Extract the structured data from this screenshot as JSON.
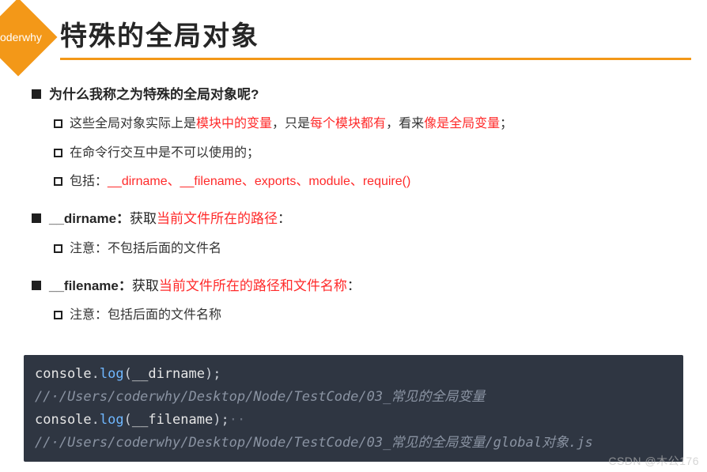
{
  "badge": "coderwhy",
  "title": "特殊的全局对象",
  "sections": [
    {
      "head": "为什么我称之为特殊的全局对象呢?",
      "items": [
        {
          "segments": [
            {
              "t": "这些全局对象实际上是",
              "c": ""
            },
            {
              "t": "模块中的变量",
              "c": "red"
            },
            {
              "t": "，只是",
              "c": ""
            },
            {
              "t": "每个模块都有",
              "c": "red"
            },
            {
              "t": "，看来",
              "c": ""
            },
            {
              "t": "像是全局变量",
              "c": "red"
            },
            {
              "t": "；",
              "c": ""
            }
          ]
        },
        {
          "segments": [
            {
              "t": "在命令行交互中是不可以使用的；",
              "c": ""
            }
          ]
        },
        {
          "segments": [
            {
              "t": "包括：",
              "c": ""
            },
            {
              "t": "__dirname、__filename、exports、module、require()",
              "c": "red"
            }
          ]
        }
      ]
    },
    {
      "head_segments": [
        {
          "t": "__dirname：",
          "c": ""
        },
        {
          "t": "获取",
          "c": "plain"
        },
        {
          "t": "当前文件所在的路径",
          "c": "red"
        },
        {
          "t": "：",
          "c": "plain"
        }
      ],
      "items": [
        {
          "segments": [
            {
              "t": "注意：不包括后面的文件名",
              "c": ""
            }
          ]
        }
      ]
    },
    {
      "head_segments": [
        {
          "t": "__filename：",
          "c": ""
        },
        {
          "t": "获取",
          "c": "plain"
        },
        {
          "t": "当前文件所在的路径和文件名称",
          "c": "red"
        },
        {
          "t": "：",
          "c": "plain"
        }
      ],
      "items": [
        {
          "segments": [
            {
              "t": "注意：包括后面的文件名称",
              "c": ""
            }
          ]
        }
      ]
    }
  ],
  "code": {
    "line1": {
      "obj": "console",
      "fn": "log",
      "arg": "__dirname"
    },
    "comment1": "//·/Users/coderwhy/Desktop/Node/TestCode/03_常见的全局变量",
    "line2": {
      "obj": "console",
      "fn": "log",
      "arg": "__filename"
    },
    "comment2": "//·/Users/coderwhy/Desktop/Node/TestCode/03_常见的全局变量/global对象.js"
  },
  "watermark": "CSDN @木公176"
}
